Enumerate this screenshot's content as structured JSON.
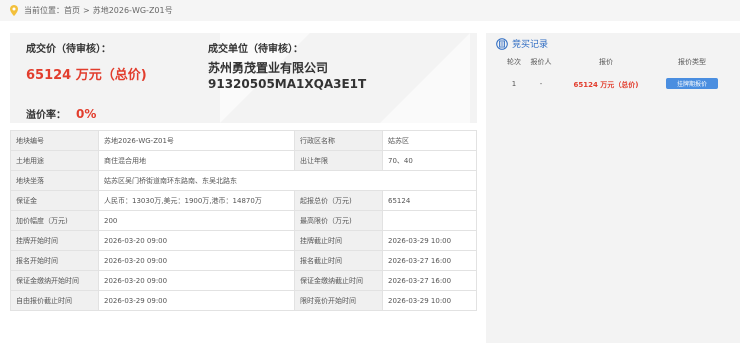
{
  "breadcrumb": {
    "prefix": "当前位置：",
    "home": "首页",
    "separator": ">",
    "current": "苏地2026-WG-Z01号"
  },
  "summary": {
    "price_label": "成交价（待审核）：",
    "price_value": "65124 万元（总价)",
    "buyer_label": "成交单位（待审核）：",
    "buyer_name": "苏州勇茂置业有限公司",
    "buyer_code": "91320505MA1XQA3E1T",
    "premium_label": "溢价率：",
    "premium_value": "0%"
  },
  "bid_record": {
    "title": "竞买记录",
    "columns": [
      "轮次",
      "报价人",
      "报价",
      "报价类型"
    ],
    "rows": [
      {
        "round": "1",
        "bidder": "-",
        "price": "65124 万元（总价)",
        "type": "挂牌期报价"
      }
    ]
  },
  "details": [
    [
      {
        "k": "地块编号",
        "v": "苏地2026-WG-Z01号"
      },
      {
        "k": "行政区名称",
        "v": "姑苏区"
      }
    ],
    [
      {
        "k": "土地用途",
        "v": "商住混合用地"
      },
      {
        "k": "出让年限",
        "v": "70、40"
      }
    ],
    [
      {
        "k": "地块坐落",
        "v": "姑苏区吴门桥街道南环东路南、东吴北路东"
      }
    ],
    [
      {
        "k": "保证金",
        "v": "人民币：13030万,美元：1900万,港币：14870万"
      },
      {
        "k": "起报总价（万元)",
        "v": "65124"
      }
    ],
    [
      {
        "k": "加价幅度（万元)",
        "v": "200"
      },
      {
        "k": "最高限价（万元)",
        "v": ""
      }
    ],
    [
      {
        "k": "挂牌开始时间",
        "v": "2026-03-20 09:00"
      },
      {
        "k": "挂牌截止时间",
        "v": "2026-03-29 10:00"
      }
    ],
    [
      {
        "k": "报名开始时间",
        "v": "2026-03-20 09:00"
      },
      {
        "k": "报名截止时间",
        "v": "2026-03-27 16:00"
      }
    ],
    [
      {
        "k": "保证金缴纳开始时间",
        "v": "2026-03-20 09:00"
      },
      {
        "k": "保证金缴纳截止时间",
        "v": "2026-03-27 16:00"
      }
    ],
    [
      {
        "k": "自由报价截止时间",
        "v": "2026-03-29 09:00"
      },
      {
        "k": "限时竞价开始时间",
        "v": "2026-03-29 10:00"
      }
    ]
  ],
  "colors": {
    "accent_red": "#e23d2d",
    "link_blue": "#2d6bc2",
    "tag_blue": "#4a8ee0",
    "pin_yellow": "#f3c03b"
  },
  "icons": {
    "breadcrumb": "location-pin-icon",
    "bid_header": "bid-record-icon"
  }
}
